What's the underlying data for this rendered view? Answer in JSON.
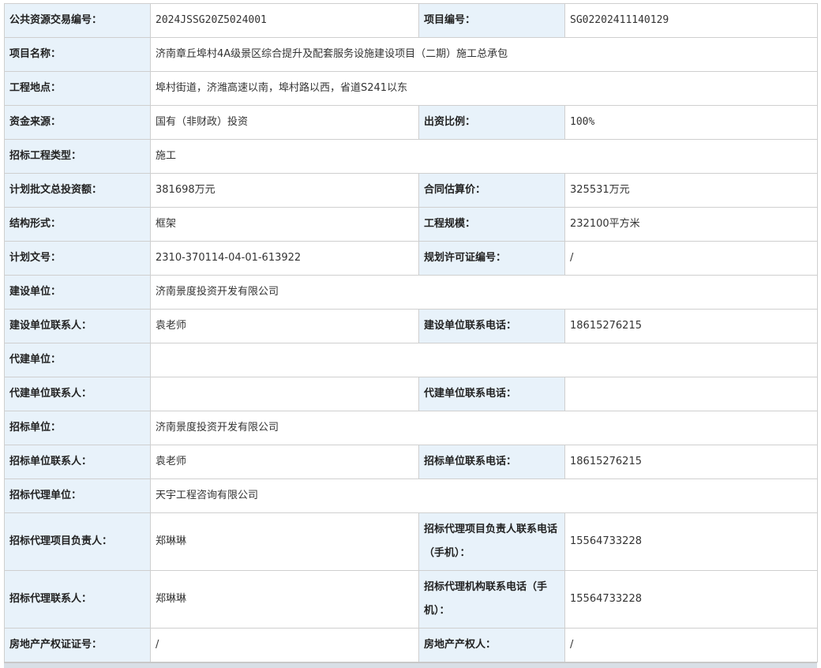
{
  "rows": [
    {
      "l1": "公共资源交易编号：",
      "v1": "2024JSSG20Z5024001",
      "l2": "项目编号：",
      "v2": "SG02202411140129"
    },
    {
      "l1": "项目名称：",
      "v1": "济南章丘埠村4A级景区综合提升及配套服务设施建设项目（二期）施工总承包"
    },
    {
      "l1": "工程地点：",
      "v1": "埠村街道，济潍高速以南，埠村路以西，省道S241以东"
    },
    {
      "l1": "资金来源：",
      "v1": "国有（非财政）投资",
      "l2": "出资比例：",
      "v2": "100%"
    },
    {
      "l1": "招标工程类型：",
      "v1": "施工"
    },
    {
      "l1": "计划批文总投资额：",
      "v1": "381698万元",
      "l2": "合同估算价：",
      "v2": "325531万元"
    },
    {
      "l1": "结构形式：",
      "v1": "框架",
      "l2": "工程规模：",
      "v2": "232100平方米"
    },
    {
      "l1": "计划文号：",
      "v1": "2310-370114-04-01-613922",
      "l2": "规划许可证编号：",
      "v2": "/"
    },
    {
      "l1": "建设单位：",
      "v1": "济南景度投资开发有限公司"
    },
    {
      "l1": "建设单位联系人：",
      "v1": "袁老师",
      "l2": "建设单位联系电话：",
      "v2": "18615276215"
    },
    {
      "l1": "代建单位：",
      "v1": ""
    },
    {
      "l1": "代建单位联系人：",
      "v1": "",
      "l2": "代建单位联系电话：",
      "v2": ""
    },
    {
      "l1": "招标单位：",
      "v1": "济南景度投资开发有限公司"
    },
    {
      "l1": "招标单位联系人：",
      "v1": "袁老师",
      "l2": "招标单位联系电话：",
      "v2": "18615276215"
    },
    {
      "l1": "招标代理单位：",
      "v1": "天宇工程咨询有限公司"
    },
    {
      "l1": "招标代理项目负责人：",
      "v1": "郑琳琳",
      "l2": "招标代理项目负责人联系电话（手机）：",
      "v2": "15564733228"
    },
    {
      "l1": "招标代理联系人：",
      "v1": "郑琳琳",
      "l2": "招标代理机构联系电话（手机）：",
      "v2": "15564733228"
    },
    {
      "l1": "房地产产权证证号：",
      "v1": "/",
      "l2": "房地产产权人：",
      "v2": "/"
    }
  ]
}
